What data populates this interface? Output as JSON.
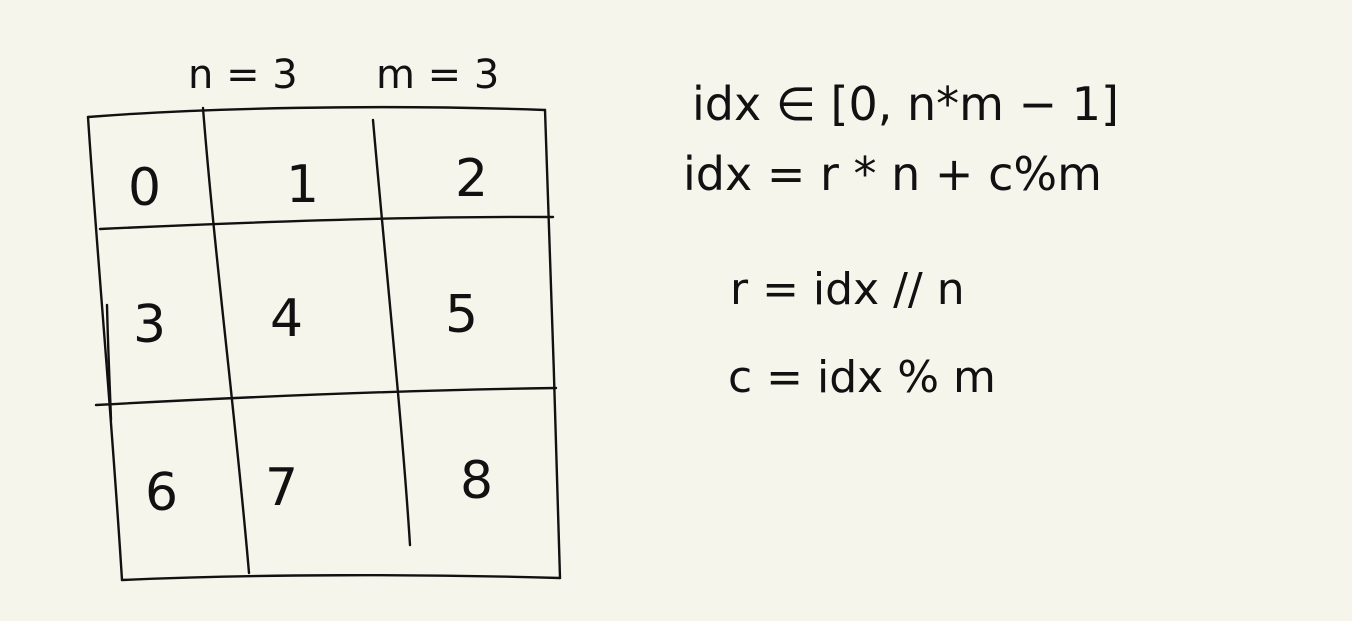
{
  "header": {
    "n_label": "n = 3",
    "m_label": "m = 3"
  },
  "grid": {
    "rows": 3,
    "cols": 3,
    "cells": [
      "0",
      "1",
      "2",
      "3",
      "4",
      "5",
      "6",
      "7",
      "8"
    ]
  },
  "formulas": {
    "range": "idx ∈ [0, n*m − 1]",
    "index": "idx =  r * n + c%m",
    "row": "r =  idx // n",
    "col": "c =  idx % m"
  },
  "colors": {
    "background": "#f6f5ec",
    "ink": "#111111"
  }
}
